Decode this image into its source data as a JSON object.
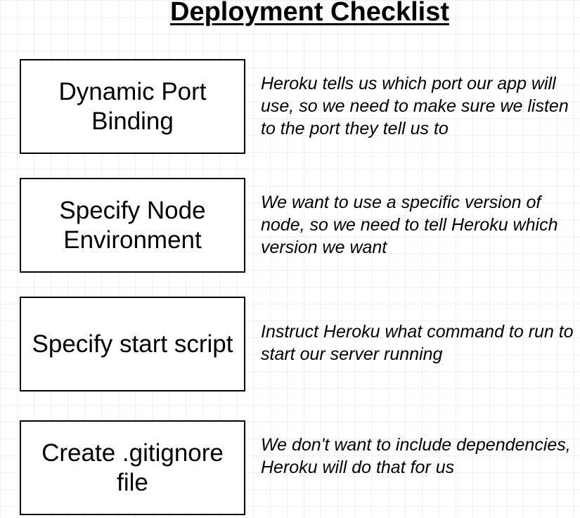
{
  "title": "Deployment Checklist",
  "steps": [
    {
      "label": "Dynamic Port Binding",
      "description": "Heroku tells us which port our app will use, so we need to make sure we listen to the port they tell us to"
    },
    {
      "label": "Specify Node Environment",
      "description": "We want to use a specific version of node, so we need to tell Heroku which version we want"
    },
    {
      "label": "Specify start script",
      "description": "Instruct Heroku what command to run to start our server running"
    },
    {
      "label": "Create .gitignore file",
      "description": "We don't want to include dependencies, Heroku will do that for us"
    }
  ]
}
